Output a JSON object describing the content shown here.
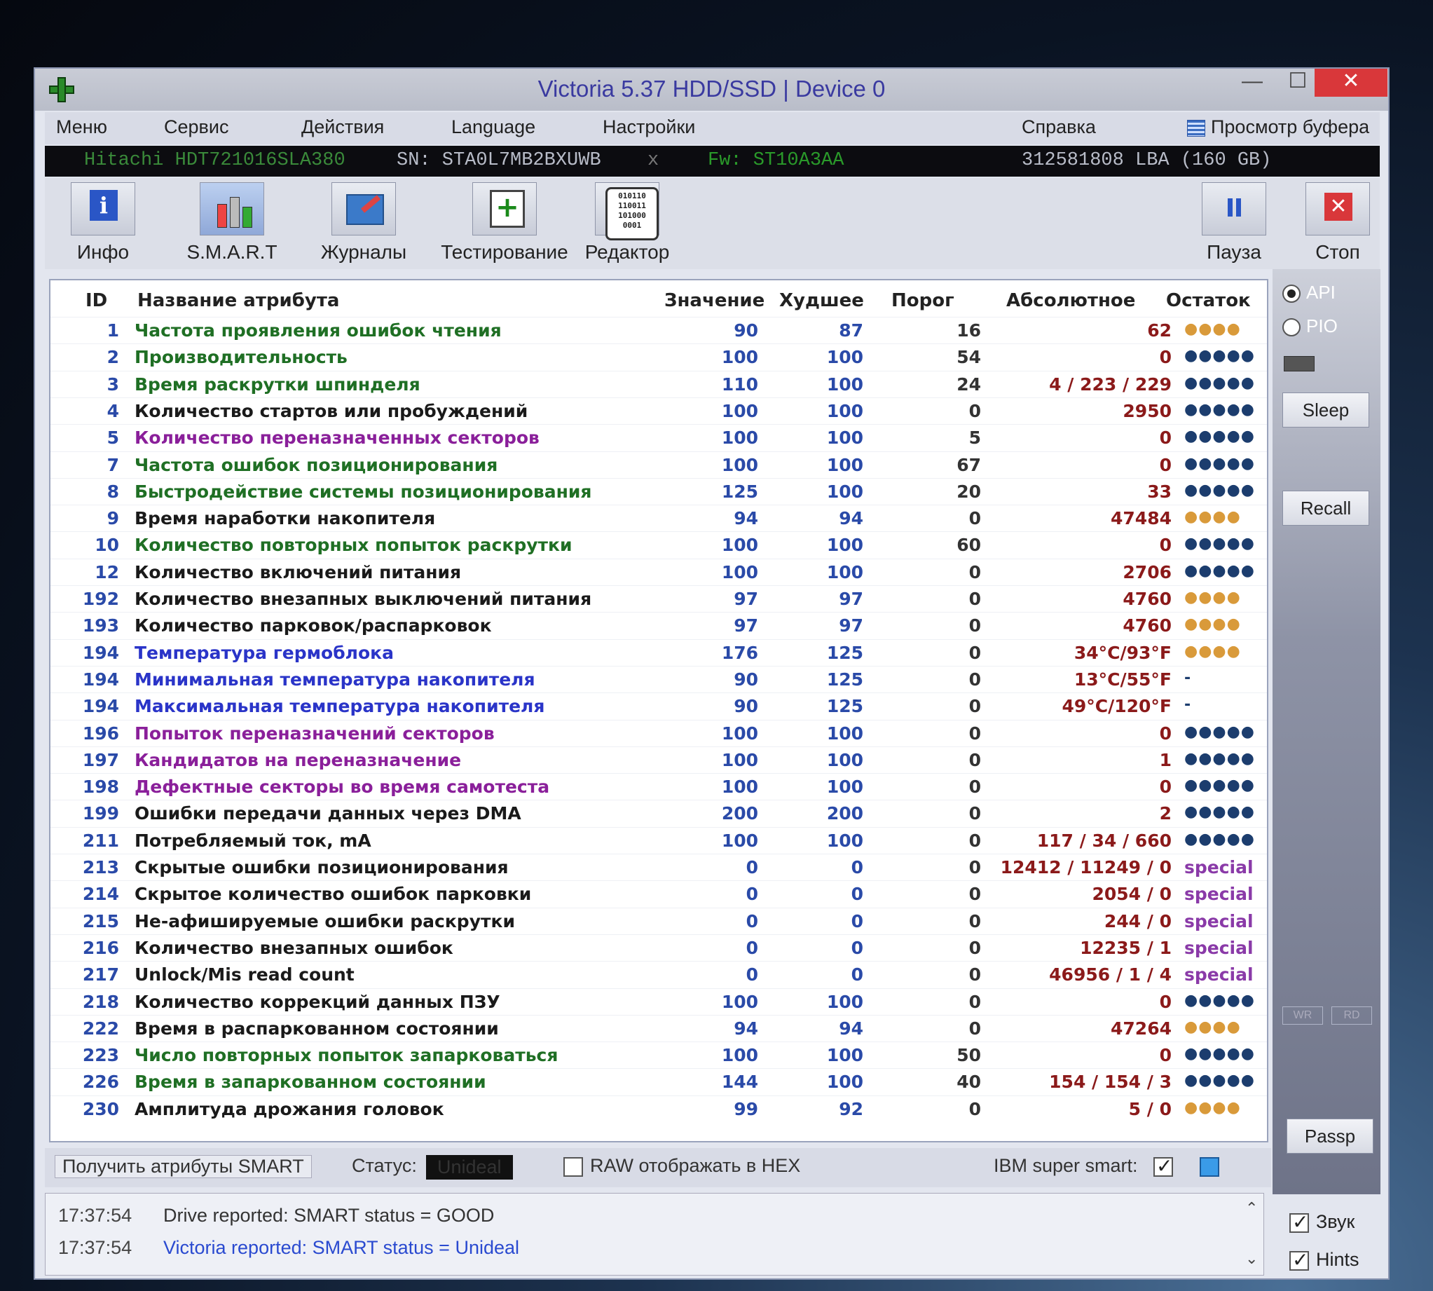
{
  "window": {
    "title": "Victoria 5.37 HDD/SSD | Device 0",
    "min": "—",
    "max": "☐",
    "close": "✕"
  },
  "menu": [
    "Меню",
    "Сервис",
    "Действия",
    "Language",
    "Настройки",
    "Справка"
  ],
  "buffer_view": "Просмотр буфера",
  "drive": {
    "model": "Hitachi HDT721016SLA380",
    "serial": "SN: STA0L7MB2BXUWB",
    "sep": "x",
    "firmware": "Fw: ST10A3AA",
    "lba": "312581808 LBA (160 GB)"
  },
  "tools": [
    "Инфо",
    "S.M.A.R.T",
    "Журналы",
    "Тестирование",
    "Редактор",
    "Пауза",
    "Стоп"
  ],
  "headers": {
    "id": "ID",
    "name": "Название атрибута",
    "value": "Значение",
    "worst": "Худшее",
    "threshold": "Порог",
    "raw": "Абсолютное",
    "remain": "Остаток"
  },
  "colors": {
    "green": "#1f6f24",
    "black": "#1a1a1a",
    "purple": "#8a1f9a",
    "blue": "#2a34c8",
    "teal": "#1a7a4a"
  },
  "rows": [
    {
      "id": "1",
      "name": "Частота проявления ошибок чтения",
      "color": "#1f6f24",
      "value": "90",
      "worst": "87",
      "thr": "16",
      "raw": "62",
      "rem": "●●●●",
      "cls": "g4"
    },
    {
      "id": "2",
      "name": "Производительность",
      "color": "#1f6f24",
      "value": "100",
      "worst": "100",
      "thr": "54",
      "raw": "0",
      "rem": "●●●●●",
      "cls": "g5"
    },
    {
      "id": "3",
      "name": "Время раскрутки шпинделя",
      "color": "#1f6f24",
      "value": "110",
      "worst": "100",
      "thr": "24",
      "raw": "4 / 223 / 229",
      "rem": "●●●●●",
      "cls": "g5"
    },
    {
      "id": "4",
      "name": "Количество стартов или пробуждений",
      "color": "#1a1a1a",
      "value": "100",
      "worst": "100",
      "thr": "0",
      "raw": "2950",
      "rem": "●●●●●",
      "cls": "g5"
    },
    {
      "id": "5",
      "name": "Количество переназначенных секторов",
      "color": "#8a1f9a",
      "value": "100",
      "worst": "100",
      "thr": "5",
      "raw": "0",
      "rem": "●●●●●",
      "cls": "g5"
    },
    {
      "id": "7",
      "name": "Частота ошибок позиционирования",
      "color": "#1f6f24",
      "value": "100",
      "worst": "100",
      "thr": "67",
      "raw": "0",
      "rem": "●●●●●",
      "cls": "g5"
    },
    {
      "id": "8",
      "name": "Быстродействие системы позиционирования",
      "color": "#1f6f24",
      "value": "125",
      "worst": "100",
      "thr": "20",
      "raw": "33",
      "rem": "●●●●●",
      "cls": "g5"
    },
    {
      "id": "9",
      "name": "Время наработки накопителя",
      "color": "#1a1a1a",
      "value": "94",
      "worst": "94",
      "thr": "0",
      "raw": "47484",
      "rem": "●●●●",
      "cls": "g4"
    },
    {
      "id": "10",
      "name": "Количество повторных попыток раскрутки",
      "color": "#1f6f24",
      "value": "100",
      "worst": "100",
      "thr": "60",
      "raw": "0",
      "rem": "●●●●●",
      "cls": "g5"
    },
    {
      "id": "12",
      "name": "Количество включений питания",
      "color": "#1a1a1a",
      "value": "100",
      "worst": "100",
      "thr": "0",
      "raw": "2706",
      "rem": "●●●●●",
      "cls": "g5"
    },
    {
      "id": "192",
      "name": "Количество внезапных выключений питания",
      "color": "#1a1a1a",
      "value": "97",
      "worst": "97",
      "thr": "0",
      "raw": "4760",
      "rem": "●●●●",
      "cls": "g4"
    },
    {
      "id": "193",
      "name": "Количество парковок/распарковок",
      "color": "#1a1a1a",
      "value": "97",
      "worst": "97",
      "thr": "0",
      "raw": "4760",
      "rem": "●●●●",
      "cls": "g4"
    },
    {
      "id": "194",
      "name": "Температура гермоблока",
      "color": "#2a34c8",
      "value": "176",
      "worst": "125",
      "thr": "0",
      "raw": "34°C/93°F",
      "rem": "●●●●",
      "cls": "g4"
    },
    {
      "id": "194",
      "name": "Минимальная температура накопителя",
      "color": "#2a34c8",
      "value": "90",
      "worst": "125",
      "thr": "0",
      "raw": "13°C/55°F",
      "rem": "-",
      "cls": "g5"
    },
    {
      "id": "194",
      "name": "Максимальная температура накопителя",
      "color": "#2a34c8",
      "value": "90",
      "worst": "125",
      "thr": "0",
      "raw": "49°C/120°F",
      "rem": "-",
      "cls": "g5"
    },
    {
      "id": "196",
      "name": "Попыток переназначений секторов",
      "color": "#8a1f9a",
      "value": "100",
      "worst": "100",
      "thr": "0",
      "raw": "0",
      "rem": "●●●●●",
      "cls": "g5"
    },
    {
      "id": "197",
      "name": "Кандидатов на переназначение",
      "color": "#8a1f9a",
      "value": "100",
      "worst": "100",
      "thr": "0",
      "raw": "1",
      "rem": "●●●●●",
      "cls": "g5"
    },
    {
      "id": "198",
      "name": "Дефектные секторы во время самотеста",
      "color": "#8a1f9a",
      "value": "100",
      "worst": "100",
      "thr": "0",
      "raw": "0",
      "rem": "●●●●●",
      "cls": "g5"
    },
    {
      "id": "199",
      "name": "Ошибки передачи данных через DMA",
      "color": "#1a1a1a",
      "value": "200",
      "worst": "200",
      "thr": "0",
      "raw": "2",
      "rem": "●●●●●",
      "cls": "g5"
    },
    {
      "id": "211",
      "name": "Потребляемый ток, mA",
      "color": "#1a1a1a",
      "value": "100",
      "worst": "100",
      "thr": "0",
      "raw": "117 / 34 / 660",
      "rem": "●●●●●",
      "cls": "g5"
    },
    {
      "id": "213",
      "name": "Скрытые ошибки позиционирования",
      "color": "#1a1a1a",
      "value": "0",
      "worst": "0",
      "thr": "0",
      "raw": "12412 / 11249 / 0",
      "rem": "special",
      "cls": "sp"
    },
    {
      "id": "214",
      "name": "Скрытое количество ошибок парковки",
      "color": "#1a1a1a",
      "value": "0",
      "worst": "0",
      "thr": "0",
      "raw": "2054 / 0",
      "rem": "special",
      "cls": "sp"
    },
    {
      "id": "215",
      "name": "Не-афишируемые ошибки раскрутки",
      "color": "#1a1a1a",
      "value": "0",
      "worst": "0",
      "thr": "0",
      "raw": "244 / 0",
      "rem": "special",
      "cls": "sp"
    },
    {
      "id": "216",
      "name": "Количество внезапных ошибок",
      "color": "#1a1a1a",
      "value": "0",
      "worst": "0",
      "thr": "0",
      "raw": "12235 / 1",
      "rem": "special",
      "cls": "sp"
    },
    {
      "id": "217",
      "name": "Unlock/Mis read count",
      "color": "#1a1a1a",
      "value": "0",
      "worst": "0",
      "thr": "0",
      "raw": "46956 / 1 / 4",
      "rem": "special",
      "cls": "sp"
    },
    {
      "id": "218",
      "name": "Количество коррекций данных ПЗУ",
      "color": "#1a1a1a",
      "value": "100",
      "worst": "100",
      "thr": "0",
      "raw": "0",
      "rem": "●●●●●",
      "cls": "g5"
    },
    {
      "id": "222",
      "name": "Время в распаркованном состоянии",
      "color": "#1a1a1a",
      "value": "94",
      "worst": "94",
      "thr": "0",
      "raw": "47264",
      "rem": "●●●●",
      "cls": "g4"
    },
    {
      "id": "223",
      "name": "Число повторных попыток запарковаться",
      "color": "#1f6f24",
      "value": "100",
      "worst": "100",
      "thr": "50",
      "raw": "0",
      "rem": "●●●●●",
      "cls": "g5"
    },
    {
      "id": "226",
      "name": "Время в запаркованном состоянии",
      "color": "#1f6f24",
      "value": "144",
      "worst": "100",
      "thr": "40",
      "raw": "154 / 154 / 3",
      "rem": "●●●●●",
      "cls": "g5"
    },
    {
      "id": "230",
      "name": "Амплитуда дрожания головок",
      "color": "#1a1a1a",
      "value": "99",
      "worst": "92",
      "thr": "0",
      "raw": "5 / 0",
      "rem": "●●●●",
      "cls": "g4"
    }
  ],
  "sidebar": {
    "api": "API",
    "pio": "PIO",
    "sleep": "Sleep",
    "recall": "Recall",
    "wr": "WR",
    "rd": "RD",
    "passp": "Passp"
  },
  "bottom": {
    "get_smart": "Получить атрибуты SMART",
    "status_label": "Статус:",
    "status_value": "Unideal",
    "raw_hex": "RAW отображать в HEX",
    "ibm": "IBM super smart:"
  },
  "log": [
    {
      "time": "17:37:54",
      "text": "Drive reported: SMART status = GOOD",
      "color": "#333333"
    },
    {
      "time": "17:37:54",
      "text": "Victoria reported: SMART status = Unideal",
      "color": "#2a4ad0"
    }
  ],
  "options": {
    "sound": "Звук",
    "hints": "Hints"
  }
}
